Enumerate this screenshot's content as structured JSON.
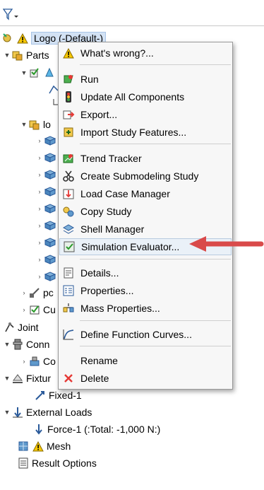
{
  "toolbar": {
    "filter_icon": "filter-icon"
  },
  "tree": {
    "root_label": "Logo (-Default-)",
    "parts_label": "Parts",
    "part_label_partial": "lo",
    "pc_label_partial": "pc",
    "cu_label_partial": "Cu",
    "joint_label": "Joint",
    "connections_label_partial": "Conn",
    "co_label_partial": "Co",
    "fixtures_label_partial": "Fixtur",
    "fixed_label": "Fixed-1",
    "external_loads_label": "External Loads",
    "force_label": "Force-1 (:Total: -1,000 N:)",
    "mesh_label": "Mesh",
    "result_options_label": "Result Options"
  },
  "menu": {
    "items": [
      {
        "label": "What's wrong?...",
        "icon": "warning-icon"
      },
      {
        "label": "Run",
        "icon": "run-icon"
      },
      {
        "label": "Update All Components",
        "icon": "traffic-light-icon"
      },
      {
        "label": "Export...",
        "icon": "export-icon"
      },
      {
        "label": "Import Study Features...",
        "icon": "import-study-icon"
      },
      {
        "label": "Trend Tracker",
        "icon": "trend-tracker-icon"
      },
      {
        "label": "Create Submodeling Study",
        "icon": "scissors-icon"
      },
      {
        "label": "Load Case Manager",
        "icon": "load-case-icon"
      },
      {
        "label": "Copy Study",
        "icon": "copy-study-icon"
      },
      {
        "label": "Shell Manager",
        "icon": "shell-manager-icon"
      },
      {
        "label": "Simulation Evaluator...",
        "icon": "evaluator-icon"
      },
      {
        "label": "Details...",
        "icon": "details-icon"
      },
      {
        "label": "Properties...",
        "icon": "properties-icon"
      },
      {
        "label": "Mass Properties...",
        "icon": "mass-properties-icon"
      },
      {
        "label": "Define Function Curves...",
        "icon": "function-curve-icon"
      },
      {
        "label": "Rename",
        "icon": ""
      },
      {
        "label": "Delete",
        "icon": "delete-icon"
      }
    ]
  },
  "colors": {
    "arrow": "#d94a4a",
    "selection": "#d3e2f4",
    "highlight": "#eaf1f8"
  }
}
